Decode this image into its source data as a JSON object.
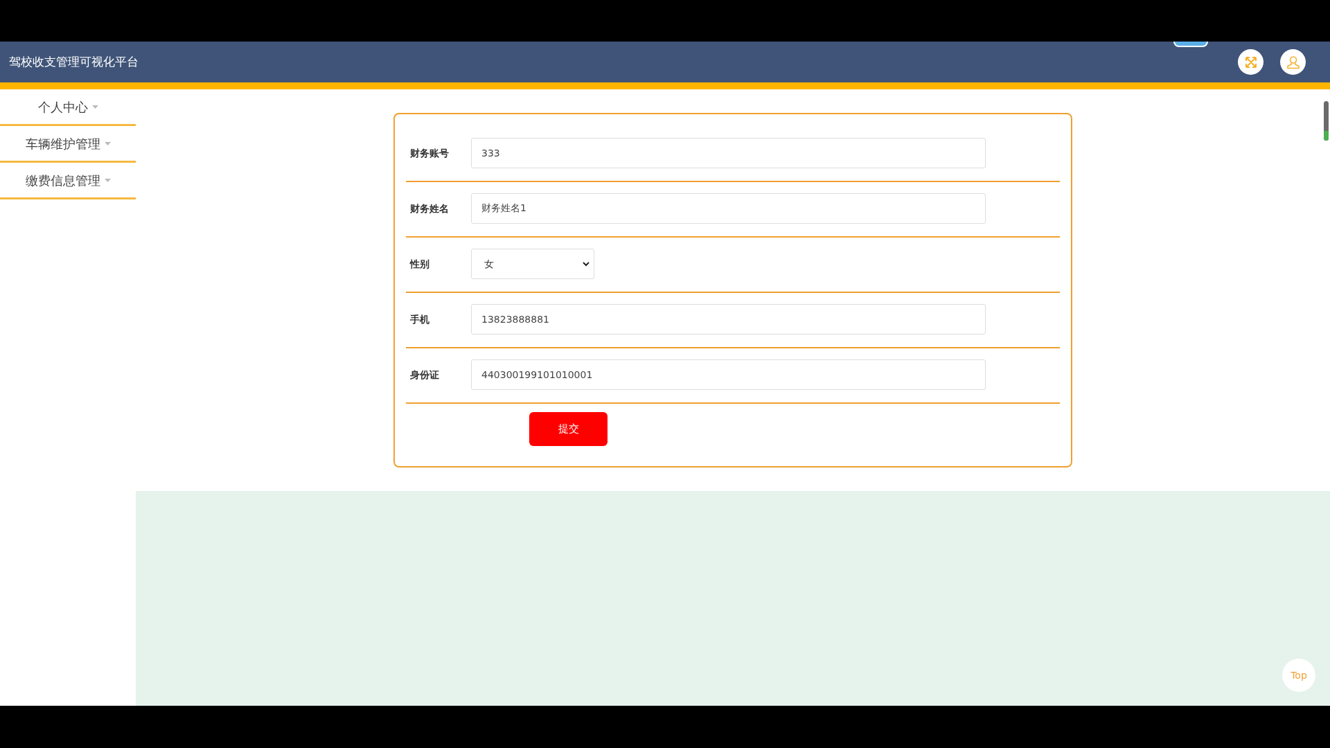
{
  "header": {
    "title": "驾校收支管理可视化平台"
  },
  "sidebar": {
    "items": [
      {
        "label": "个人中心"
      },
      {
        "label": "车辆维护管理"
      },
      {
        "label": "缴费信息管理"
      }
    ]
  },
  "form": {
    "fields": [
      {
        "kind": "text",
        "label": "财务账号",
        "value": "333"
      },
      {
        "kind": "text",
        "label": "财务姓名",
        "value": "财务姓名1"
      },
      {
        "kind": "select",
        "label": "性别",
        "value": "女"
      },
      {
        "kind": "text",
        "label": "手机",
        "value": "13823888881"
      },
      {
        "kind": "text",
        "label": "身份证",
        "value": "440300199101010001"
      }
    ],
    "submit": "提交"
  },
  "back_to_top": "Top"
}
